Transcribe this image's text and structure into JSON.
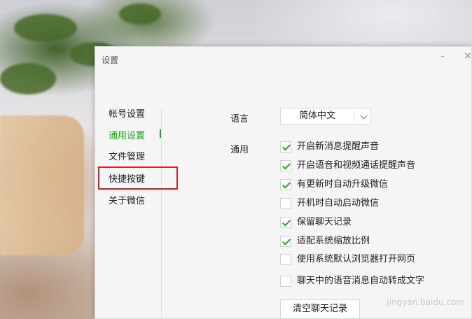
{
  "window": {
    "title": "设置",
    "minimize": "–",
    "close": "×"
  },
  "sidebar": {
    "items": [
      {
        "label": "帐号设置",
        "active": false
      },
      {
        "label": "通用设置",
        "active": true
      },
      {
        "label": "文件管理",
        "active": false
      },
      {
        "label": "快捷按键",
        "active": false,
        "highlighted": true
      },
      {
        "label": "关于微信",
        "active": false
      }
    ]
  },
  "main": {
    "language_label": "语言",
    "language_value": "简体中文",
    "general_label": "通用",
    "options": [
      {
        "label": "开启新消息提醒声音",
        "checked": true
      },
      {
        "label": "开启语音和视频通话提醒声音",
        "checked": true
      },
      {
        "label": "有更新时自动升级微信",
        "checked": true
      },
      {
        "label": "开机时自动启动微信",
        "checked": false
      },
      {
        "label": "保留聊天记录",
        "checked": true
      },
      {
        "label": "适配系统缩放比例",
        "checked": true
      },
      {
        "label": "使用系统默认浏览器打开网页",
        "checked": false
      },
      {
        "label": "聊天中的语音消息自动转成文字",
        "checked": false
      }
    ],
    "clear_button": "清空聊天记录"
  },
  "watermark": "jingyan.baidu.com",
  "colors": {
    "accent": "#1aad19",
    "highlight": "#e02020"
  }
}
